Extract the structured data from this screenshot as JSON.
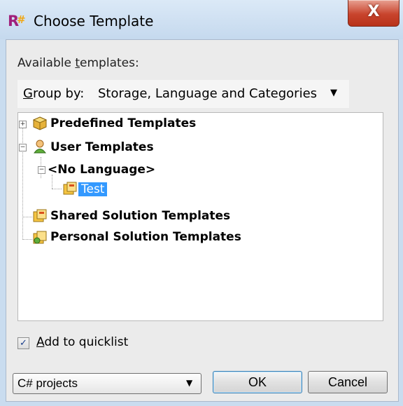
{
  "window": {
    "title": "Choose Template",
    "close_glyph": "X"
  },
  "labels": {
    "available_prefix": "Available ",
    "available_underline": "t",
    "available_suffix": "emplates:",
    "group_by_underline": "G",
    "group_by_rest": "roup by:"
  },
  "group_by": {
    "selected": "Storage, Language and Categories"
  },
  "tree": {
    "items": [
      {
        "label": "Predefined Templates",
        "icon": "package-icon",
        "expander": "+"
      },
      {
        "label": "User Templates",
        "icon": "user-icon",
        "expander": "−"
      },
      {
        "label": "<No Language>",
        "icon": "",
        "expander": "−"
      },
      {
        "label": "Test",
        "icon": "template-icon",
        "expander": "",
        "selected": true
      },
      {
        "label": "Shared Solution Templates",
        "icon": "shared-template-icon",
        "expander": ""
      },
      {
        "label": "Personal Solution Templates",
        "icon": "personal-template-icon",
        "expander": ""
      }
    ]
  },
  "quicklist": {
    "checked": true,
    "label_underline": "A",
    "label_rest": "dd to quicklist"
  },
  "project_type": {
    "selected": "C# projects"
  },
  "buttons": {
    "ok": "OK",
    "cancel": "Cancel"
  },
  "colors": {
    "selection": "#3399ff",
    "close_button": "#c8442d",
    "title_bar": "#c9dcef"
  }
}
